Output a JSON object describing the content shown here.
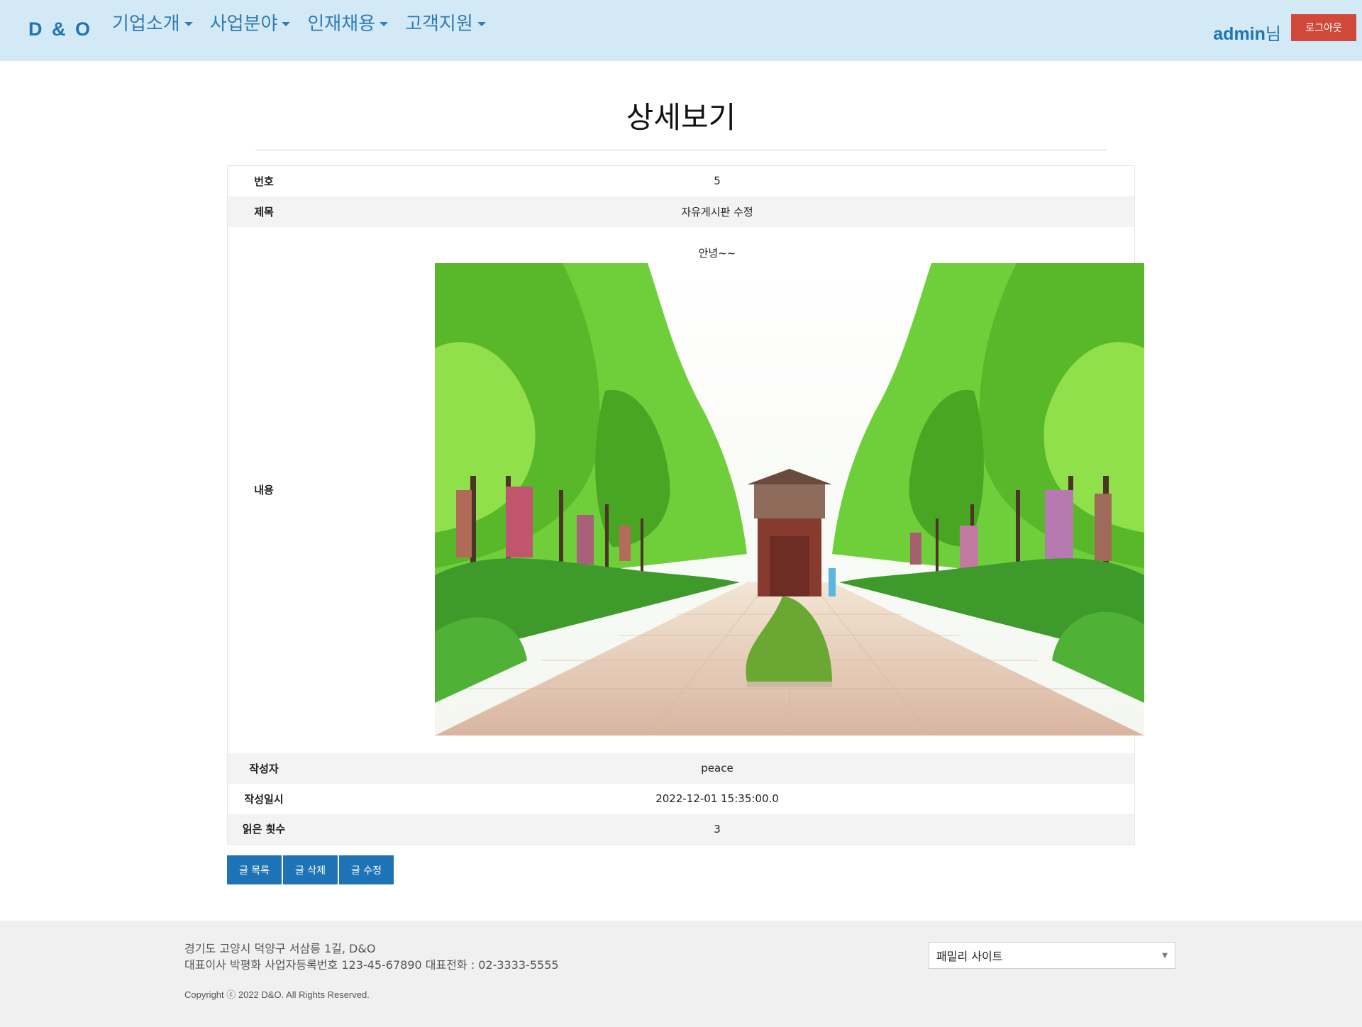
{
  "header": {
    "logo": "D & O",
    "nav": [
      {
        "label": "기업소개"
      },
      {
        "label": "사업분야"
      },
      {
        "label": "인재채용"
      },
      {
        "label": "고객지원"
      }
    ],
    "user_name": "admin",
    "user_suffix": "님",
    "logout_label": "로그아웃"
  },
  "page_title": "상세보기",
  "post": {
    "number_label": "번호",
    "number": "5",
    "subject_label": "제목",
    "subject": "자유게시판 수정",
    "content_label": "내용",
    "content_text": "안녕~~",
    "writer_label": "작성자",
    "writer": "peace",
    "date_label": "작성일시",
    "date": "2022-12-01 15:35:00.0",
    "views_label": "읽은 횟수",
    "views": "3"
  },
  "buttons": {
    "list": "글 목록",
    "delete": "글 삭제",
    "edit": "글 수정"
  },
  "footer": {
    "address": "경기도 고양시 덕양구 서삼릉 1길, D&O",
    "company_info": "대표이사 박평화 사업자등록번호 123-45-67890 대표전화 : 02-3333-5555",
    "copyright": "Copyright ⓒ 2022 D&O. All Rights Reserved.",
    "family_site": "패밀리 사이트"
  },
  "colors": {
    "header_bg": "#d3e9f5",
    "brand": "#1f74b5",
    "logout": "#d0493a",
    "button": "#1e73b6",
    "footer_bg": "#f0f0f0"
  }
}
